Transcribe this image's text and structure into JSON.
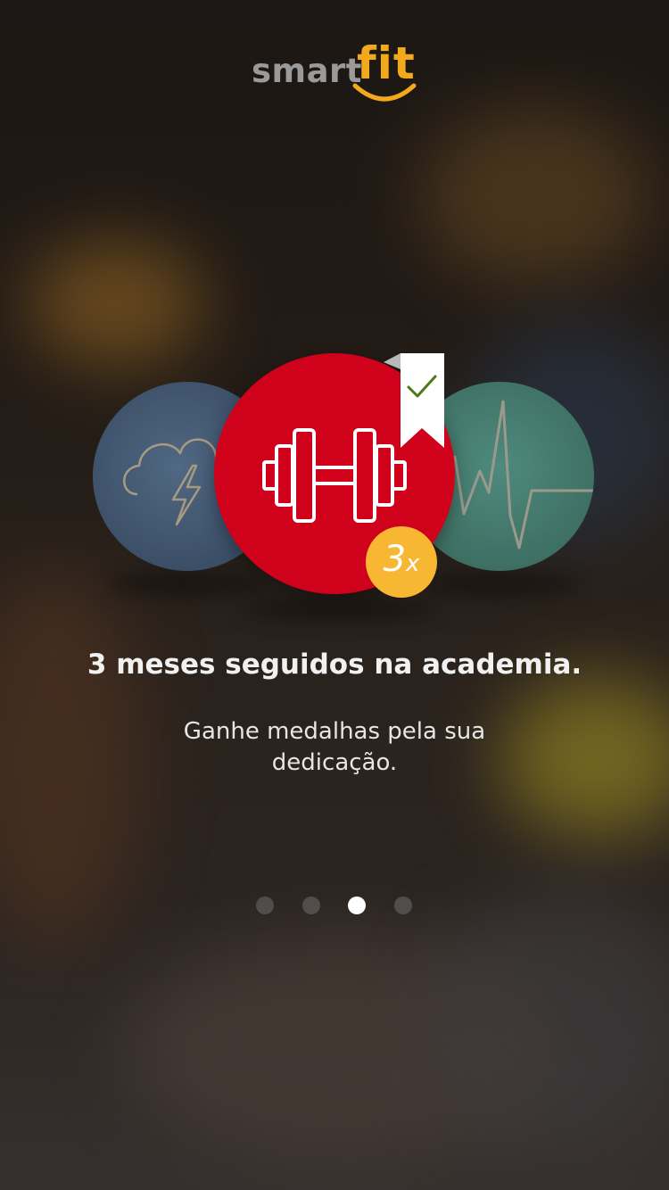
{
  "brand": {
    "logo_smart": "smart",
    "logo_fit": "fit",
    "accent_color": "#f2aa1c"
  },
  "medal": {
    "left_icon": "cloud-lightning-icon",
    "center_icon": "dumbbell-icon",
    "right_icon": "heartbeat-icon",
    "ribbon_icon": "checkmark-icon",
    "badge_count": "3",
    "badge_suffix": "x",
    "main_color": "#d0021b",
    "badge_color": "#f7b733"
  },
  "content": {
    "headline": "3 meses seguidos na academia.",
    "subtext": "Ganhe medalhas pela sua dedicação."
  },
  "pagination": {
    "total": 4,
    "active_index": 2
  }
}
